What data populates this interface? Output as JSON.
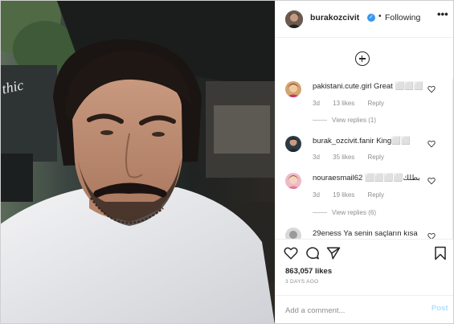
{
  "header": {
    "username": "burakozcivit",
    "verified_badge": "verified-badge-icon",
    "separator": "•",
    "following_label": "Following",
    "more_icon": "more-options-icon",
    "more_glyph": "•••"
  },
  "comments": [
    {
      "username": "pakistani.cute.girl",
      "text": "Great ⬜⬜⬜",
      "age": "3d",
      "likes": "13 likes",
      "reply": "Reply",
      "view_replies": "View replies (1)"
    },
    {
      "username": "burak_ozcivit.fanir",
      "text": "King⬜⬜",
      "age": "3d",
      "likes": "35 likes",
      "reply": "Reply",
      "view_replies": ""
    },
    {
      "username": "nouraesmail62",
      "text": "⬜⬜⬜⬜بطلك",
      "age": "3d",
      "likes": "19 likes",
      "reply": "Reply",
      "view_replies": "View replies (6)"
    },
    {
      "username": "29eness",
      "text": "Ya senin saçların kısa",
      "age": "",
      "likes": "",
      "reply": "",
      "view_replies": ""
    }
  ],
  "post": {
    "likes": "863,057 likes",
    "time_ago": "3 DAYS AGO"
  },
  "composer": {
    "placeholder": "Add a comment...",
    "post_label": "Post"
  },
  "icons": {
    "like": "heart-icon",
    "comment": "comment-icon",
    "share": "share-icon",
    "save": "bookmark-icon",
    "load_more": "plus-circle-icon"
  }
}
